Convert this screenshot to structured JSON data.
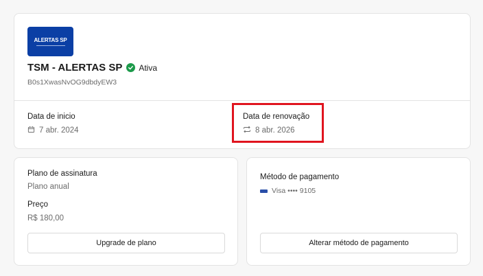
{
  "subscription": {
    "logo_text": "ALERTAS SP",
    "title": "TSM - ALERTAS SP",
    "status": "Ativa",
    "id": "B0s1XwasNvOG9dbdyEW3",
    "start_label": "Data de inicio",
    "start_date": "7 abr. 2024",
    "renewal_label": "Data de renovação",
    "renewal_date": "8 abr. 2026"
  },
  "plan": {
    "label": "Plano de assinatura",
    "value": "Plano anual",
    "price_label": "Preço",
    "price_value": "R$ 180,00",
    "upgrade_button": "Upgrade de plano"
  },
  "payment": {
    "label": "Método de pagamento",
    "card": "Visa •••• 9105",
    "change_button": "Alterar método de pagamento"
  },
  "colors": {
    "status_green": "#1c9a4a",
    "highlight_red": "#e0141e",
    "logo_blue": "#0b3fa5"
  },
  "icons": {
    "start": "calendar-icon",
    "renewal": "repeat-icon",
    "status": "check-circle-icon",
    "card": "visa-card-icon"
  }
}
